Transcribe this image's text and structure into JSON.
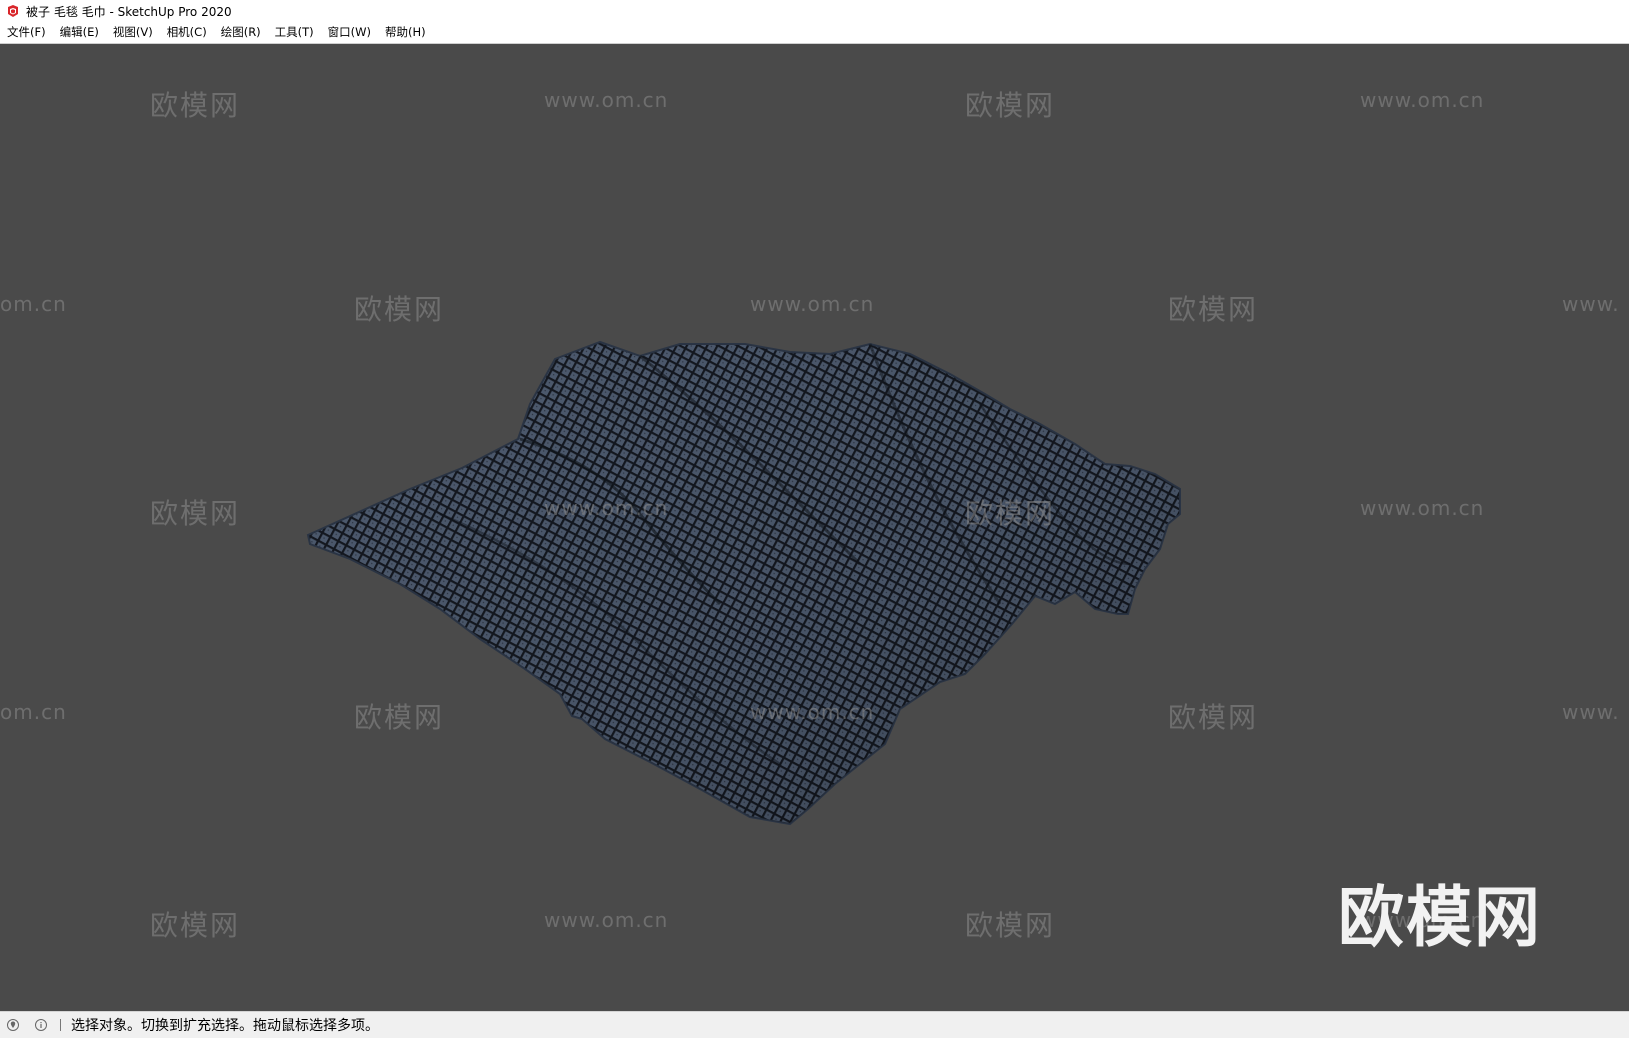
{
  "window": {
    "title": "被子 毛毯 毛巾 - SketchUp Pro 2020",
    "icon": "sketchup-logo-icon"
  },
  "menu": {
    "items": [
      {
        "label": "文件(F)"
      },
      {
        "label": "编辑(E)"
      },
      {
        "label": "视图(V)"
      },
      {
        "label": "相机(C)"
      },
      {
        "label": "绘图(R)"
      },
      {
        "label": "工具(T)"
      },
      {
        "label": "窗口(W)"
      },
      {
        "label": "帮助(H)"
      }
    ]
  },
  "viewport": {
    "background": "#4a4a4a",
    "model_color": "#3b4452",
    "watermarks": {
      "cn": "欧模网",
      "url": "www.om.cn",
      "url_left_partial": "om.cn",
      "url_right_partial": "www.",
      "big": "欧模网"
    }
  },
  "status": {
    "icons": [
      "geo-location-icon",
      "info-icon"
    ],
    "text": "选择对象。切换到扩充选择。拖动鼠标选择多项。"
  }
}
